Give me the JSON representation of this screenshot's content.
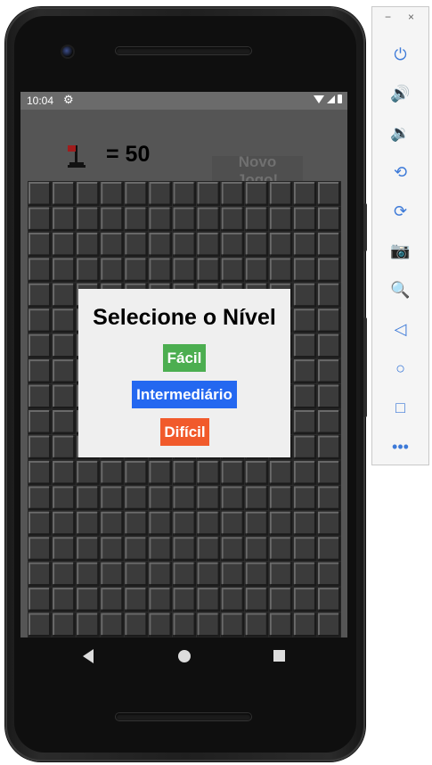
{
  "statusbar": {
    "time": "10:04",
    "settings_icon": "gear-icon"
  },
  "header": {
    "flag_count": "= 50",
    "new_game_label": "Novo Jogo!"
  },
  "board": {
    "rows": 18,
    "cols": 13
  },
  "dialog": {
    "title": "Selecione o Nível",
    "levels": [
      {
        "label": "Fácil",
        "color": "#4cae50"
      },
      {
        "label": "Intermediário",
        "color": "#2468f0"
      },
      {
        "label": "Difícil",
        "color": "#f15a2b"
      }
    ]
  },
  "navbar": [
    "back-icon",
    "home-icon",
    "recents-icon"
  ],
  "emulator_panel": {
    "window_controls": {
      "minimize": "−",
      "close": "×"
    },
    "tools": [
      {
        "name": "power-icon",
        "glyph": "⏻"
      },
      {
        "name": "volume-up-icon",
        "glyph": "🔊"
      },
      {
        "name": "volume-down-icon",
        "glyph": "🔉"
      },
      {
        "name": "rotate-left-icon",
        "glyph": "⟲"
      },
      {
        "name": "rotate-right-icon",
        "glyph": "⟳"
      },
      {
        "name": "camera-icon",
        "glyph": "📷"
      },
      {
        "name": "zoom-icon",
        "glyph": "🔍"
      },
      {
        "name": "back-icon",
        "glyph": "◁"
      },
      {
        "name": "home-icon",
        "glyph": "○"
      },
      {
        "name": "overview-icon",
        "glyph": "□"
      },
      {
        "name": "more-icon",
        "glyph": "•••"
      }
    ]
  },
  "colors": {
    "screen_bg": "#555555",
    "tile_face": "#3b3b3b",
    "tile_light": "#6a6a6a",
    "tile_dark": "#1b1b1b"
  }
}
